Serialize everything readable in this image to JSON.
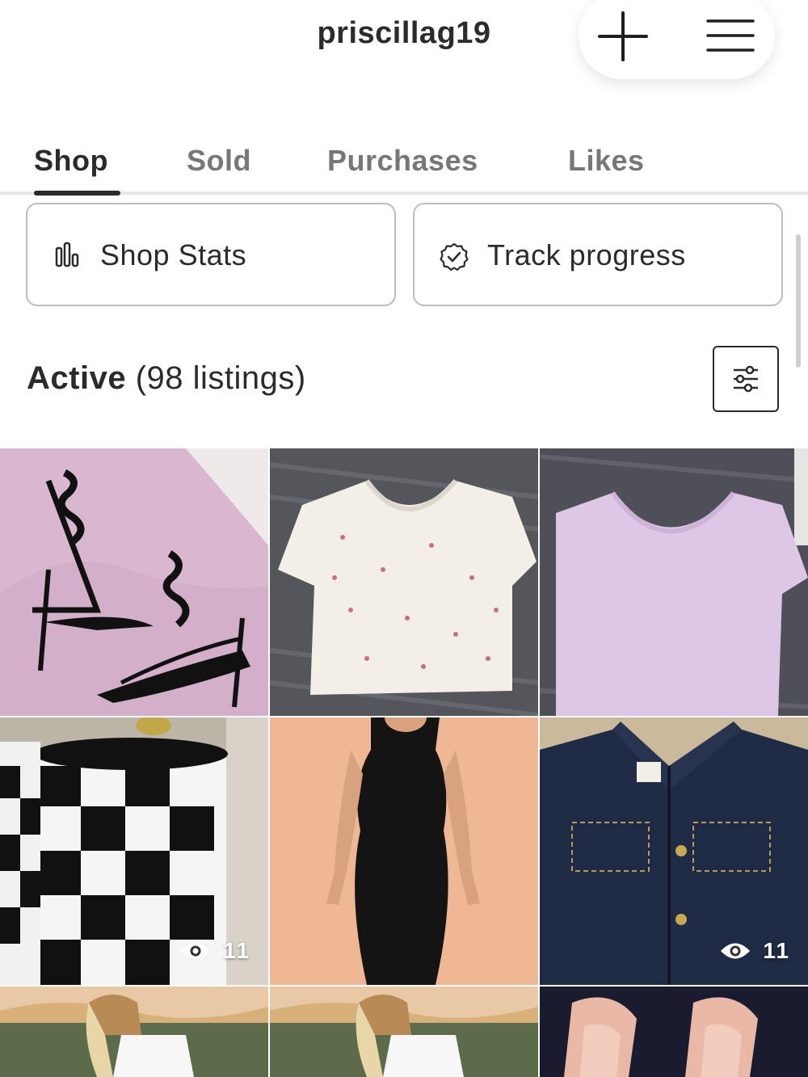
{
  "header": {
    "username": "priscillag19",
    "icons": {
      "add": "plus-icon",
      "menu": "hamburger-menu-icon"
    }
  },
  "tabs": [
    {
      "label": "Shop",
      "active": true
    },
    {
      "label": "Sold",
      "active": false
    },
    {
      "label": "Purchases",
      "active": false
    },
    {
      "label": "Likes",
      "active": false
    }
  ],
  "actions": {
    "shop_stats": {
      "label": "Shop Stats",
      "icon": "bar-chart-icon"
    },
    "track_progress": {
      "label": "Track progress",
      "icon": "verified-badge-icon"
    }
  },
  "listings_summary": {
    "status": "Active",
    "count_text": "(98 listings)",
    "filter_icon": "sliders-filter-icon"
  },
  "listings": [
    {
      "subject": "black strappy heels",
      "views": null
    },
    {
      "subject": "floral lace crop top",
      "views": null
    },
    {
      "subject": "lilac lace tee",
      "views": null
    },
    {
      "subject": "checkered canister",
      "views": "11"
    },
    {
      "subject": "black midi dress",
      "views": null
    },
    {
      "subject": "denim jacket",
      "views": "11"
    },
    {
      "subject": "white tank top",
      "views": null
    },
    {
      "subject": "white tank top",
      "views": null
    },
    {
      "subject": "pink slingback flats",
      "views": null
    }
  ],
  "colors": {
    "text": "#2b2b2b",
    "muted": "#777777",
    "border": "#bdbdbd"
  }
}
